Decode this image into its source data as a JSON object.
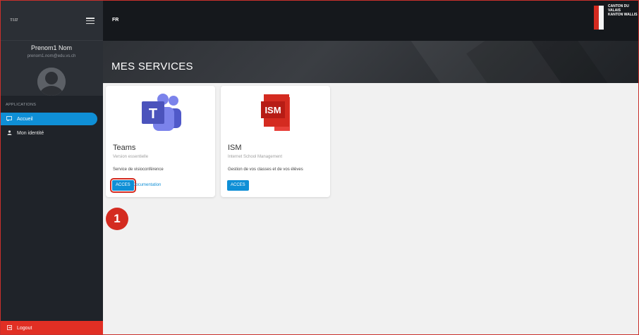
{
  "sidebar": {
    "logo_text": "τιπ",
    "user_name": "Prenom1 Nom",
    "user_email": "prenom1.nom@edu.vs.ch",
    "section_label": "APPLICATIONS",
    "items": [
      {
        "label": "Accueil",
        "icon": "chat-icon",
        "active": true
      },
      {
        "label": "Mon identité",
        "icon": "person-icon",
        "active": false
      }
    ],
    "logout_label": "Logout"
  },
  "header": {
    "language": "FR",
    "canton_line1": "CANTON DU VALAIS",
    "canton_line2": "KANTON WALLIS"
  },
  "banner": {
    "title": "MES SERVICES"
  },
  "services": [
    {
      "title": "Teams",
      "subtitle": "Version essentielle",
      "description": "Service de visioconférence",
      "button_label": "ACCES",
      "link_label": "Documentation",
      "logo_letter": "T"
    },
    {
      "title": "ISM",
      "subtitle": "Internet School Management",
      "description": "Gestion de vos classes et de vos élèves",
      "button_label": "ACCES",
      "logo_letter": "ISM"
    }
  ],
  "annotation": {
    "marker_number": "1"
  },
  "colors": {
    "accent": "#0f8fd6",
    "logout": "#e12f24",
    "teams": "#4b53bc",
    "ism": "#d42b20",
    "highlight": "#d42b20"
  }
}
